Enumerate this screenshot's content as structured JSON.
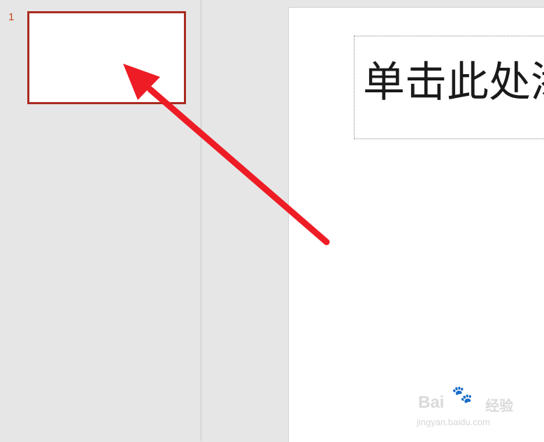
{
  "thumbnails": {
    "slides": [
      {
        "number": "1"
      }
    ]
  },
  "slide": {
    "title_placeholder": "单击此处添加标题"
  },
  "annotation": {
    "arrow_color": "#ee1c25"
  },
  "watermark": {
    "brand": "Bai",
    "paw": "🐾",
    "brand_suffix": "经验",
    "url": "jingyan.baidu.com"
  },
  "colors": {
    "thumbnail_border": "#a82b1f",
    "slide_number": "#c5471f",
    "pane_background": "#e6e6e6"
  }
}
